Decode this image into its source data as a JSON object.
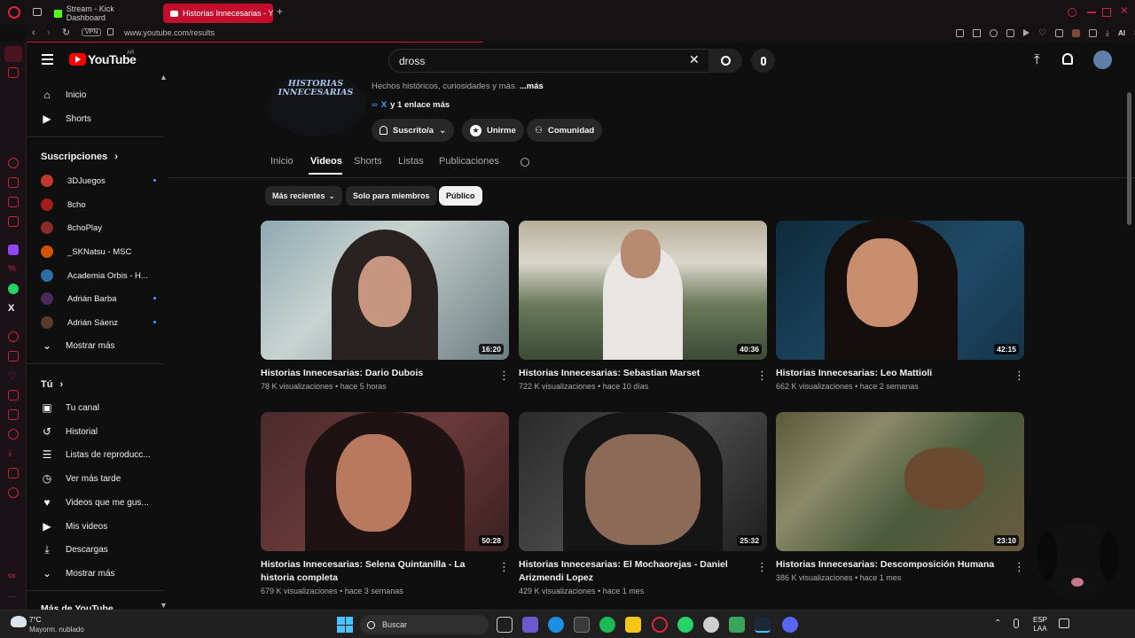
{
  "browser": {
    "tabs": [
      {
        "label": "Stream - Kick Dashboard"
      },
      {
        "label": "Historias Innecesarias - Yo"
      }
    ],
    "vpn": "VPN",
    "url": "www.youtube.com/results",
    "ai_label": "AI"
  },
  "youtube": {
    "logo": "YouTube",
    "region": "AR",
    "search_value": "dross",
    "nav": {
      "main": [
        {
          "label": "Inicio"
        },
        {
          "label": "Shorts"
        }
      ],
      "subs_title": "Suscripciones",
      "subs": [
        {
          "label": "3DJuegos",
          "color": "#c0392b"
        },
        {
          "label": "8cho",
          "color": "#a61b1b"
        },
        {
          "label": "8choPlay",
          "color": "#8a2b2b"
        },
        {
          "label": "_SKNatsu - MSC",
          "color": "#d35400"
        },
        {
          "label": "Academia Orbis - H...",
          "color": "#2e6da4"
        },
        {
          "label": "Adrián Barba",
          "color": "#4a2a5a"
        },
        {
          "label": "Adrián Sáenz",
          "color": "#5a3a2a"
        }
      ],
      "show_more": "Mostrar más",
      "you_title": "Tú",
      "you": [
        {
          "label": "Tu canal"
        },
        {
          "label": "Historial"
        },
        {
          "label": "Listas de reproducc..."
        },
        {
          "label": "Ver más tarde"
        },
        {
          "label": "Videos que me gus..."
        },
        {
          "label": "Mis videos"
        },
        {
          "label": "Descargas"
        },
        {
          "label": "Mostrar más"
        }
      ],
      "more_title": "Más de YouTube"
    },
    "channel": {
      "logo_text": "HISTORIAS INNECESARIAS",
      "desc": "Hechos históricos, curiosidades y más.",
      "desc_more": "...más",
      "links_x": "X",
      "links": "y 1 enlace más",
      "subscribed": "Suscrito/a",
      "join": "Unirme",
      "community": "Comunidad"
    },
    "tabs": [
      "Inicio",
      "Videos",
      "Shorts",
      "Listas",
      "Publicaciones"
    ],
    "active_tab": "Videos",
    "chips": [
      "Más recientes",
      "Solo para miembros",
      "Público"
    ],
    "videos": [
      {
        "title": "Historias Innecesarias: Dario Dubois",
        "views": "78 K visualizaciones",
        "age": "hace 5 horas",
        "duration": "16:20"
      },
      {
        "title": "Historias Innecesarias: Sebastian Marset",
        "views": "722 K visualizaciones",
        "age": "hace 10 días",
        "duration": "40:36"
      },
      {
        "title": "Historias Innecesarias: Leo Mattioli",
        "views": "662 K visualizaciones",
        "age": "hace 2 semanas",
        "duration": "42:15"
      },
      {
        "title": "Historias Innecesarias: Selena Quintanilla - La historia completa",
        "views": "679 K visualizaciones",
        "age": "hace 3 semanas",
        "duration": "50:28"
      },
      {
        "title": "Historias Innecesarias: El Mochaorejas - Daniel Arizmendi Lopez",
        "views": "429 K visualizaciones",
        "age": "hace 1 mes",
        "duration": "25:32"
      },
      {
        "title": "Historias Innecesarias: Descomposición Humana",
        "views": "386 K visualizaciones",
        "age": "hace 1 mes",
        "duration": "23:10"
      }
    ]
  },
  "taskbar": {
    "temp": "7°C",
    "weather": "Mayorm. nublado",
    "search": "Buscar",
    "lang1": "ESP",
    "lang2": "LAA"
  }
}
